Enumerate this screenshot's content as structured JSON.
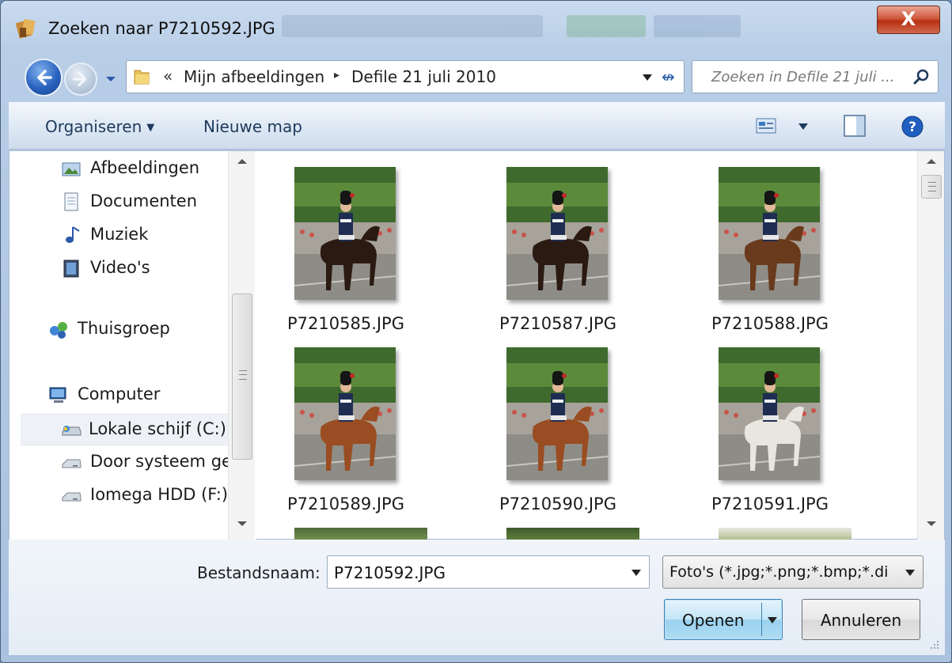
{
  "window": {
    "title": "Zoeken naar P7210592.JPG",
    "close_label": "X"
  },
  "nav": {
    "breadcrumb_chevron": "«",
    "breadcrumb": [
      "Mijn afbeeldingen",
      "Defile 21 juli 2010"
    ],
    "crumb_separator": "▸",
    "refresh_label": "↮",
    "search_placeholder": "Zoeken in Defile 21 juli ..."
  },
  "toolbar": {
    "organise_label": "Organiseren",
    "new_folder_label": "Nieuwe map"
  },
  "sidebar": {
    "items": [
      {
        "label": "Afbeeldingen",
        "icon": "pictures-icon"
      },
      {
        "label": "Documenten",
        "icon": "documents-icon"
      },
      {
        "label": "Muziek",
        "icon": "music-icon"
      },
      {
        "label": "Video's",
        "icon": "video-icon"
      },
      {
        "label": "Thuisgroep",
        "icon": "homegroup-icon"
      },
      {
        "label": "Computer",
        "icon": "computer-icon"
      },
      {
        "label": "Lokale schijf (C:)",
        "icon": "local-disk-icon"
      },
      {
        "label": "Door systeem ger",
        "icon": "drive-icon"
      },
      {
        "label": "Iomega HDD (F:)",
        "icon": "drive-icon"
      }
    ],
    "selected_index": 6
  },
  "files": [
    {
      "name": "P7210585.JPG",
      "horse": "dark"
    },
    {
      "name": "P7210587.JPG",
      "horse": "dark"
    },
    {
      "name": "P7210588.JPG",
      "horse": "brown"
    },
    {
      "name": "P7210589.JPG",
      "horse": "chestnut"
    },
    {
      "name": "P7210590.JPG",
      "horse": "chestnut"
    },
    {
      "name": "P7210591.JPG",
      "horse": "white"
    }
  ],
  "footer": {
    "filename_label": "Bestandsnaam:",
    "filename_value": "P7210592.JPG",
    "filetype_value": "Foto's (*.jpg;*.png;*.bmp;*.di",
    "open_label": "Openen",
    "cancel_label": "Annuleren"
  },
  "colors": {
    "accent": "#2a63c0",
    "close": "#c9472a",
    "selection": "#eef2f7"
  }
}
